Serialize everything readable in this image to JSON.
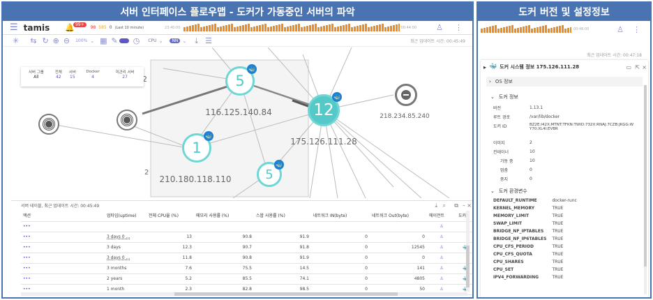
{
  "left_banner": "서버 인터페이스 플로우맵 - 도커가 가동중인 서버의 파악",
  "right_banner": "도커 버전 및 설정정보",
  "app": {
    "name": "tamis",
    "alert_count": "99+",
    "stat1": "98",
    "stat2": "585",
    "stat3": "0",
    "period": "(Last 10 minute)",
    "t_start": "23:40:00",
    "t_end": "00:44:00"
  },
  "toolbar": {
    "zoom": "100%",
    "cpu": "CPU",
    "nn": "NN",
    "updated": "최근 업데이트 시간: 00:45:49"
  },
  "summary": {
    "headers": [
      "서버 그룹",
      "전체",
      "서버",
      "Docker",
      "미관리 서버"
    ],
    "values": [
      "All",
      "42",
      "15",
      "4",
      "27"
    ]
  },
  "nodes": [
    {
      "count": "5",
      "ip": "116.125.140.84"
    },
    {
      "count": "12",
      "ip": "175.126.111.28"
    },
    {
      "count": "1",
      "ip": "210.180.118.110"
    },
    {
      "count": "5",
      "ip": ""
    },
    {
      "count": "",
      "ip": "218.234.85.240"
    }
  ],
  "clipped_labels": [
    "2",
    "2"
  ],
  "table": {
    "title": "서버 테이블, 최근 업데이트 시간: 00:45:49",
    "headers": [
      "액션",
      "",
      "업타임(uptime)",
      "전체 CPU율 (%)",
      "메모리 사용률 (%)",
      "스왑 사용률 (%)",
      "네트워크 IN(byte)",
      "네트워크 Out(byte)",
      "에이전트",
      "도커"
    ],
    "rows": [
      {
        "uptime": "",
        "cpu": "",
        "mem": "",
        "swap": "",
        "in": "",
        "out": "",
        "docker": false
      },
      {
        "uptime": "3 days 0 ...",
        "cpu": "13",
        "mem": "90.8",
        "swap": "91.9",
        "in": "0",
        "out": "0",
        "docker": false
      },
      {
        "uptime": "3 days",
        "cpu": "12.3",
        "mem": "90.7",
        "swap": "91.8",
        "in": "0",
        "out": "12545",
        "docker": true
      },
      {
        "uptime": "3 days 0 ...",
        "cpu": "11.8",
        "mem": "90.8",
        "swap": "91.9",
        "in": "0",
        "out": "0",
        "docker": false
      },
      {
        "uptime": "3 months",
        "cpu": "7.6",
        "mem": "75.5",
        "swap": "14.5",
        "in": "0",
        "out": "141",
        "docker": true
      },
      {
        "uptime": "2 years",
        "cpu": "5.2",
        "mem": "85.5",
        "swap": "74.1",
        "in": "0",
        "out": "4805",
        "docker": true
      },
      {
        "uptime": "1 month",
        "cpu": "2.3",
        "mem": "82.8",
        "swap": "98.5",
        "in": "0",
        "out": "50",
        "docker": true
      }
    ]
  },
  "right": {
    "t_start": "00:46:00",
    "updated": "최근 업데이트 시간: 00:47:18",
    "title": "도커 시스템 정보 175.126.111.28",
    "os_section": "OS 정보",
    "docker_section": "도커 정보",
    "docker_info": [
      {
        "k": "버전",
        "v": "1.13.1"
      },
      {
        "k": "루트 경로",
        "v": "/var/lib/docker"
      },
      {
        "k": "도커 ID",
        "v": "BZ2E:I42X:MTNT:TFKN:TWID:732X:RNAJ:7CZB:JKGG:WY70:XL4I:EVBR"
      },
      {
        "k": "이미지",
        "v": "2"
      },
      {
        "k": "컨테이너",
        "v": "10"
      },
      {
        "k": "가동 중",
        "v": "10"
      },
      {
        "k": "멈춤",
        "v": "0"
      },
      {
        "k": "중지",
        "v": "0"
      }
    ],
    "env_section": "도커 환경변수",
    "env": [
      {
        "k": "DEFAULT_RUNTIME",
        "v": "docker-runc"
      },
      {
        "k": "KERNEL_MEMORY",
        "v": "TRUE"
      },
      {
        "k": "MEMORY_LIMIT",
        "v": "TRUE"
      },
      {
        "k": "SWAP_LIMIT",
        "v": "TRUE"
      },
      {
        "k": "BRIDGE_NF_IPTABLES",
        "v": "TRUE"
      },
      {
        "k": "BRIDGE_NF_IP6TABLES",
        "v": "TRUE"
      },
      {
        "k": "CPU_CFS_PERIOD",
        "v": "TRUE"
      },
      {
        "k": "CPU_CFS_QUOTA",
        "v": "TRUE"
      },
      {
        "k": "CPU_SHARES",
        "v": "TRUE"
      },
      {
        "k": "CPU_SET",
        "v": "TRUE"
      },
      {
        "k": "IPV4_FORWARDING",
        "v": "TRUE"
      }
    ]
  },
  "colors": {
    "accent": "#4a73b2",
    "node": "#6fd6d6",
    "bar": "#f08c1c",
    "icon": "#7b79cf"
  }
}
